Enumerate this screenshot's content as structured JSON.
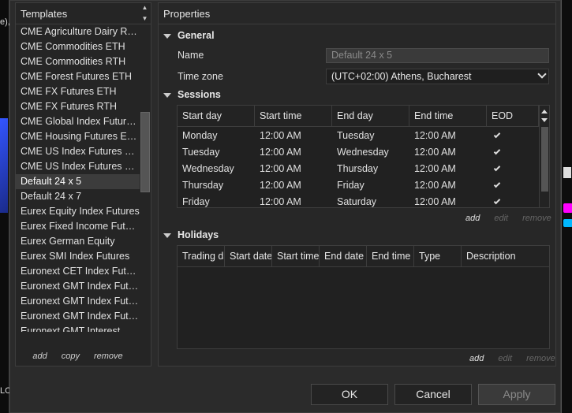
{
  "background": {
    "left_fragment_top": "e),",
    "left_fragment_bottom": "LO"
  },
  "templates": {
    "title": "Templates",
    "items": [
      "CME Agriculture Dairy RTH",
      "CME Commodities ETH",
      "CME Commodities RTH",
      "CME Forest Futures ETH",
      "CME FX Futures ETH",
      "CME FX Futures RTH",
      "CME Global Index Futures ETH",
      "CME Housing Futures ETH",
      "CME US Index Futures ETH",
      "CME US Index Futures RTH",
      "Default 24 x 5",
      "Default 24 x 7",
      "Eurex Equity Index Futures",
      "Eurex Fixed Income Futures",
      "Eurex German Equity",
      "Eurex SMI Index Futures",
      "Euronext CET Index Futures",
      "Euronext GMT Index Futures",
      "Euronext GMT Index Futures",
      "Euronext GMT Index Futures",
      "Euronext GMT Interest Rate"
    ],
    "selected_index": 10,
    "actions": {
      "add": "add",
      "copy": "copy",
      "remove": "remove"
    }
  },
  "properties": {
    "title": "Properties",
    "general": {
      "heading": "General",
      "name_label": "Name",
      "name_value": "Default 24 x 5",
      "timezone_label": "Time zone",
      "timezone_value": "(UTC+02:00) Athens, Bucharest"
    },
    "sessions": {
      "heading": "Sessions",
      "columns": [
        "Start day",
        "Start time",
        "End day",
        "End time",
        "EOD"
      ],
      "rows": [
        {
          "start_day": "Monday",
          "start_time": "12:00 AM",
          "end_day": "Tuesday",
          "end_time": "12:00 AM",
          "eod": true
        },
        {
          "start_day": "Tuesday",
          "start_time": "12:00 AM",
          "end_day": "Wednesday",
          "end_time": "12:00 AM",
          "eod": true
        },
        {
          "start_day": "Wednesday",
          "start_time": "12:00 AM",
          "end_day": "Thursday",
          "end_time": "12:00 AM",
          "eod": true
        },
        {
          "start_day": "Thursday",
          "start_time": "12:00 AM",
          "end_day": "Friday",
          "end_time": "12:00 AM",
          "eod": true
        },
        {
          "start_day": "Friday",
          "start_time": "12:00 AM",
          "end_day": "Saturday",
          "end_time": "12:00 AM",
          "eod": true
        }
      ],
      "actions": {
        "add": "add",
        "edit": "edit",
        "remove": "remove"
      }
    },
    "holidays": {
      "heading": "Holidays",
      "columns": [
        "Trading day",
        "Start date",
        "Start time",
        "End date",
        "End time",
        "Type",
        "Description"
      ],
      "rows": [],
      "actions": {
        "add": "add",
        "edit": "edit",
        "remove": "remove"
      }
    }
  },
  "footer": {
    "ok": "OK",
    "cancel": "Cancel",
    "apply": "Apply"
  }
}
